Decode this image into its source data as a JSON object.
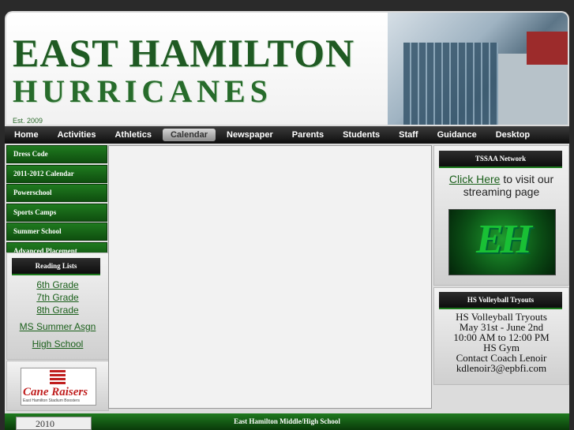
{
  "header": {
    "title_line1": "EAST HAMILTON",
    "title_line2": "HURRICANES",
    "established": "Est. 2009"
  },
  "nav": [
    "Home",
    "Activities",
    "Athletics",
    "Calendar",
    "Newspaper",
    "Parents",
    "Students",
    "Staff",
    "Guidance",
    "Desktop"
  ],
  "nav_active": "Calendar",
  "sidebar": {
    "items": [
      "Dress Code",
      "2011-2012 Calendar",
      "Powerschool",
      "Sports Camps",
      "Summer School",
      "Advanced Placement"
    ]
  },
  "reading": {
    "header": "Reading Lists",
    "links": [
      "6th Grade",
      "7th Grade",
      "8th Grade"
    ],
    "links2": [
      "MS Summer Asgn",
      "High School"
    ]
  },
  "logo": {
    "text": "Cane Raisers",
    "sub": "East Hamilton Stadium Boosters"
  },
  "tssaa": {
    "header": "TSSAA Network",
    "link": "Click Here",
    "text": " to visit our streaming page",
    "logo_text": "EH"
  },
  "volleyball": {
    "header": "HS Volleyball Tryouts",
    "lines": [
      "HS Volleyball Tryouts",
      "May 31st - June 2nd",
      "10:00 AM to 12:00 PM",
      "HS Gym",
      "Contact Coach Lenoir",
      "kdlenoir3@epbfi.com"
    ]
  },
  "footer": {
    "text": "East Hamilton Middle/High School",
    "badge": "2010"
  }
}
